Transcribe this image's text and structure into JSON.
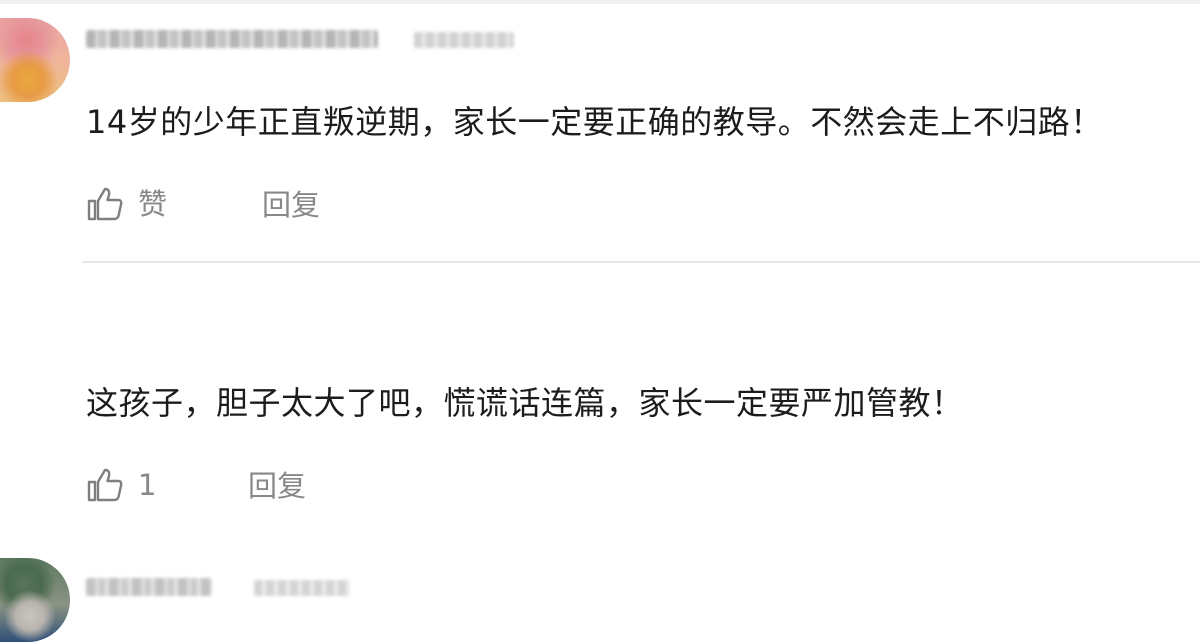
{
  "comments": [
    {
      "text": "14岁的少年正直叛逆期，家长一定要正确的教导。不然会走上不归路！",
      "like_label": "赞",
      "reply_label": "回复"
    },
    {
      "text": "这孩子，胆子太大了吧，慌谎话连篇，家长一定要严加管教！",
      "like_label": "1",
      "reply_label": "回复"
    }
  ],
  "icons": {
    "like": "thumbs-up-icon"
  },
  "colors": {
    "text": "#1c1c1c",
    "action": "#888888",
    "divider": "#e6e6e6"
  }
}
